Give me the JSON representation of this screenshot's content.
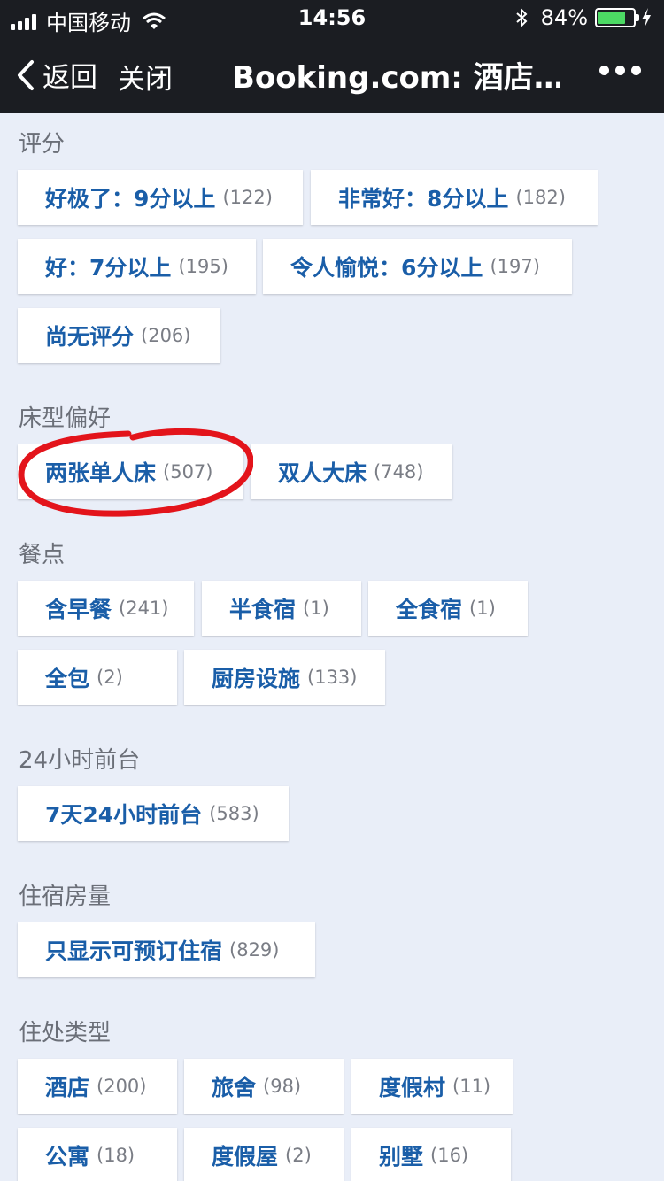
{
  "status_bar": {
    "carrier": "中国移动",
    "time": "14:56",
    "battery_percent": "84%"
  },
  "nav": {
    "back_label": "返回",
    "close_label": "关闭",
    "title": "Booking.com: 酒店…"
  },
  "sections": {
    "rating": {
      "title": "评分",
      "chips": [
        {
          "prefix": "好极了：",
          "bold": "9",
          "suffix": "分以上",
          "count": "(122)"
        },
        {
          "prefix": "非常好：",
          "bold": "8",
          "suffix": "分以上",
          "count": "(182)"
        },
        {
          "prefix": "好：",
          "bold": "7",
          "suffix": "分以上",
          "count": "(195)"
        },
        {
          "prefix": "令人愉悦：",
          "bold": "6",
          "suffix": "分以上",
          "count": "(197)"
        },
        {
          "prefix": "尚无评分",
          "bold": "",
          "suffix": "",
          "count": "(206)"
        }
      ]
    },
    "bed": {
      "title": "床型偏好",
      "chips": [
        {
          "label": "两张单人床",
          "count": "(507)"
        },
        {
          "label": "双人大床",
          "count": "(748)"
        }
      ]
    },
    "meals": {
      "title": "餐点",
      "chips": [
        {
          "label": "含早餐",
          "count": "(241)"
        },
        {
          "label": "半食宿",
          "count": "(1)"
        },
        {
          "label": "全食宿",
          "count": "(1)"
        },
        {
          "label": "全包",
          "count": "(2)"
        },
        {
          "label": "厨房设施",
          "count": "(133)"
        }
      ]
    },
    "front_desk": {
      "title": "24小时前台",
      "chips": [
        {
          "label": "7天24小时前台",
          "count": "(583)"
        }
      ]
    },
    "availability": {
      "title": "住宿房量",
      "chips": [
        {
          "label": "只显示可预订住宿",
          "count": "(829)"
        }
      ]
    },
    "property_type": {
      "title": "住处类型",
      "chips": [
        {
          "label": "酒店",
          "count": "(200)"
        },
        {
          "label": "旅舍",
          "count": "(98)"
        },
        {
          "label": "度假村",
          "count": "(11)"
        },
        {
          "label": "公寓",
          "count": "(18)"
        },
        {
          "label": "度假屋",
          "count": "(2)"
        },
        {
          "label": "别墅",
          "count": "(16)"
        }
      ]
    }
  },
  "colors": {
    "nav_bg": "#1b1d22",
    "page_bg": "#e9eef8",
    "chip_text": "#1a5ea8",
    "annotation": "#e3141b",
    "battery": "#4cd964"
  }
}
